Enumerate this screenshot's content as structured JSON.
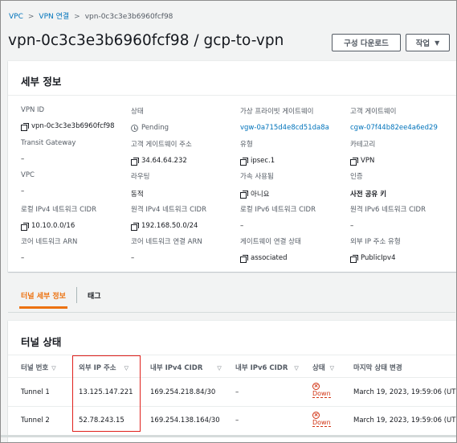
{
  "breadcrumb": {
    "items": [
      "VPC",
      "VPN 연결",
      "vpn-0c3c3e3b6960fcf98"
    ]
  },
  "page": {
    "title": "vpn-0c3c3e3b6960fcf98 / gcp-to-vpn"
  },
  "actions": {
    "download_label": "구성 다운로드",
    "actions_label": "작업"
  },
  "details": {
    "heading": "세부 정보",
    "fields": [
      {
        "label": "VPN ID",
        "value": "vpn-0c3c3e3b6960fcf98"
      },
      {
        "label": "상태",
        "value": "Pending"
      },
      {
        "label": "가상 프라이빗 게이트웨이",
        "value": "vgw-0a715d4e8cd51da8a"
      },
      {
        "label": "고객 게이트웨이",
        "value": "cgw-07f44b82ee4a6ed29"
      },
      {
        "label": "Transit Gateway",
        "value": "–"
      },
      {
        "label": "고객 게이트웨이 주소",
        "value": "34.64.64.232"
      },
      {
        "label": "유형",
        "value": "ipsec.1"
      },
      {
        "label": "카테고리",
        "value": "VPN"
      },
      {
        "label": "VPC",
        "value": "–"
      },
      {
        "label": "라우팅",
        "value": "동적"
      },
      {
        "label": "가속 사용됨",
        "value": "아니요"
      },
      {
        "label": "인증",
        "value": "사전 공유 키"
      },
      {
        "label": "로컬 IPv4 네트워크 CIDR",
        "value": "10.10.0.0/16"
      },
      {
        "label": "원격 IPv4 네트워크 CIDR",
        "value": "192.168.50.0/24"
      },
      {
        "label": "로컬 IPv6 네트워크 CIDR",
        "value": "–"
      },
      {
        "label": "원격 IPv6 네트워크 CIDR",
        "value": "–"
      },
      {
        "label": "코어 네트워크 ARN",
        "value": "–"
      },
      {
        "label": "코어 네트워크 연결 ARN",
        "value": "–"
      },
      {
        "label": "게이트웨이 연결 상태",
        "value": "associated"
      },
      {
        "label": "외부 IP 주소 유형",
        "value": "PublicIpv4"
      }
    ]
  },
  "tabs": {
    "tunnel_details": "터널 세부 정보",
    "tags": "태그"
  },
  "tunnels": {
    "heading": "터널 상태",
    "columns": [
      "터널 번호",
      "외부 IP 주소",
      "내부 IPv4 CIDR",
      "내부 IPv6 CIDR",
      "상태",
      "마지막 상태 변경"
    ],
    "rows": [
      {
        "number": "Tunnel 1",
        "outside_ip": "13.125.147.221",
        "inside_ipv4": "169.254.218.84/30",
        "inside_ipv6": "–",
        "status": "Down",
        "last_change": "March 19, 2023, 19:59:06 (UT"
      },
      {
        "number": "Tunnel 2",
        "outside_ip": "52.78.243.15",
        "inside_ipv4": "169.254.138.164/30",
        "inside_ipv6": "–",
        "status": "Down",
        "last_change": "March 19, 2023, 19:59:06 (UT"
      }
    ]
  },
  "colors": {
    "link": "#0073bb",
    "active_tab": "#ec7211",
    "error": "#d13212",
    "highlight": "#e0201b"
  }
}
